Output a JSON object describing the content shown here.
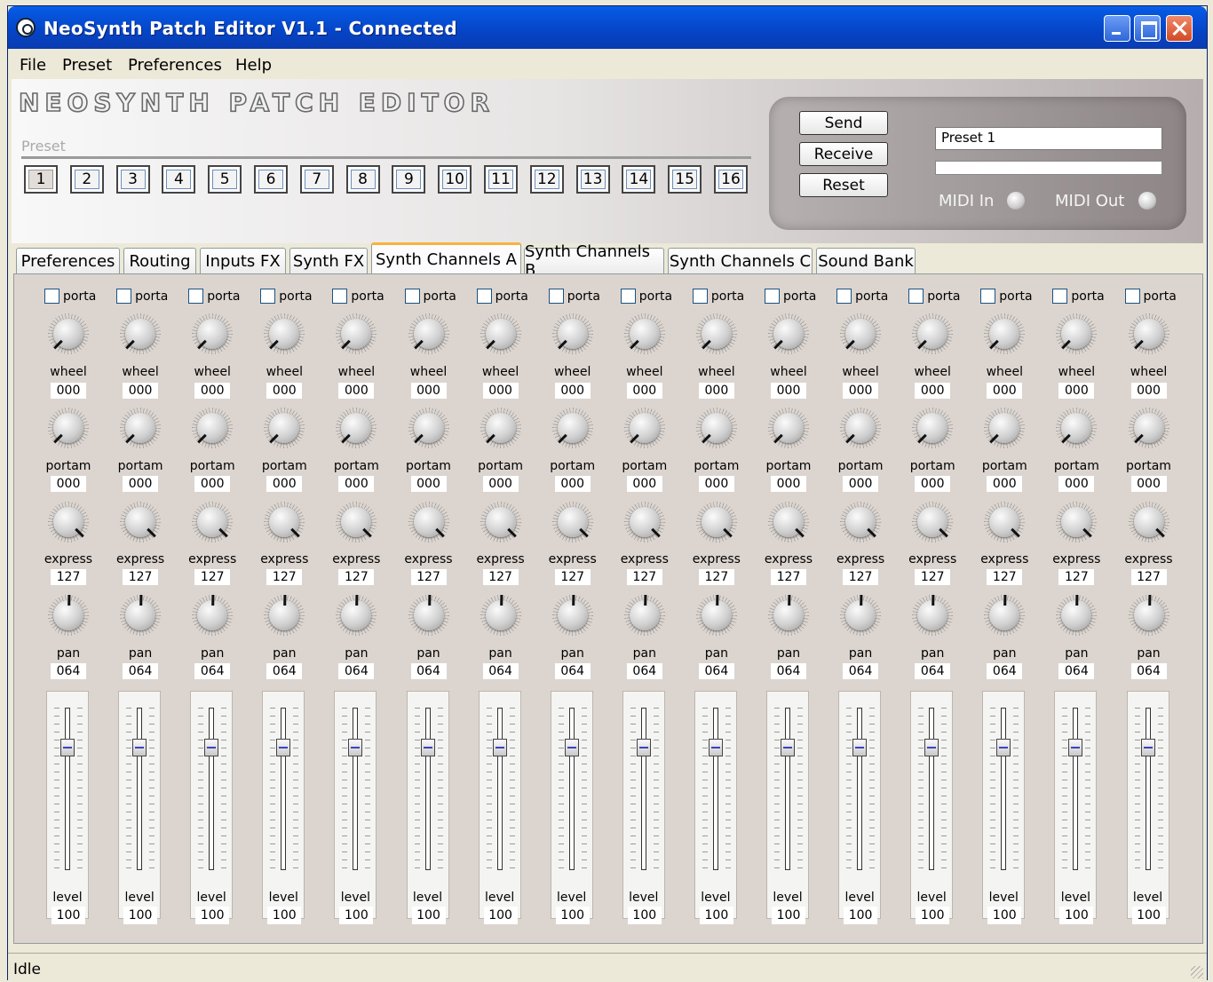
{
  "window": {
    "title": "NeoSynth Patch Editor V1.1 - Connected"
  },
  "menu": [
    "File",
    "Preset",
    "Preferences",
    "Help"
  ],
  "header": {
    "logo": "NEOSYNTH PATCH EDITOR",
    "preset_label": "Preset",
    "preset_buttons": [
      "1",
      "2",
      "3",
      "4",
      "5",
      "6",
      "7",
      "8",
      "9",
      "10",
      "11",
      "12",
      "13",
      "14",
      "15",
      "16"
    ],
    "selected_preset": "1"
  },
  "controls": {
    "send": "Send",
    "receive": "Receive",
    "reset": "Reset",
    "preset_name": "Preset 1",
    "progress": 0,
    "midi_in": "MIDI In",
    "midi_out": "MIDI Out"
  },
  "tabs": [
    "Preferences",
    "Routing",
    "Inputs FX",
    "Synth FX",
    "Synth Channels A",
    "Synth Channels B",
    "Synth Channels C",
    "Sound Bank"
  ],
  "active_tab": "Synth Channels A",
  "channel_labels": {
    "porta": "porta",
    "wheel": "wheel",
    "portam": "portam",
    "express": "express",
    "pan": "pan",
    "level": "level"
  },
  "channels": [
    {
      "porta": false,
      "wheel": "000",
      "portam": "000",
      "express": "127",
      "pan": "064",
      "level": "100"
    },
    {
      "porta": false,
      "wheel": "000",
      "portam": "000",
      "express": "127",
      "pan": "064",
      "level": "100"
    },
    {
      "porta": false,
      "wheel": "000",
      "portam": "000",
      "express": "127",
      "pan": "064",
      "level": "100"
    },
    {
      "porta": false,
      "wheel": "000",
      "portam": "000",
      "express": "127",
      "pan": "064",
      "level": "100"
    },
    {
      "porta": false,
      "wheel": "000",
      "portam": "000",
      "express": "127",
      "pan": "064",
      "level": "100"
    },
    {
      "porta": false,
      "wheel": "000",
      "portam": "000",
      "express": "127",
      "pan": "064",
      "level": "100"
    },
    {
      "porta": false,
      "wheel": "000",
      "portam": "000",
      "express": "127",
      "pan": "064",
      "level": "100"
    },
    {
      "porta": false,
      "wheel": "000",
      "portam": "000",
      "express": "127",
      "pan": "064",
      "level": "100"
    },
    {
      "porta": false,
      "wheel": "000",
      "portam": "000",
      "express": "127",
      "pan": "064",
      "level": "100"
    },
    {
      "porta": false,
      "wheel": "000",
      "portam": "000",
      "express": "127",
      "pan": "064",
      "level": "100"
    },
    {
      "porta": false,
      "wheel": "000",
      "portam": "000",
      "express": "127",
      "pan": "064",
      "level": "100"
    },
    {
      "porta": false,
      "wheel": "000",
      "portam": "000",
      "express": "127",
      "pan": "064",
      "level": "100"
    },
    {
      "porta": false,
      "wheel": "000",
      "portam": "000",
      "express": "127",
      "pan": "064",
      "level": "100"
    },
    {
      "porta": false,
      "wheel": "000",
      "portam": "000",
      "express": "127",
      "pan": "064",
      "level": "100"
    },
    {
      "porta": false,
      "wheel": "000",
      "portam": "000",
      "express": "127",
      "pan": "064",
      "level": "100"
    },
    {
      "porta": false,
      "wheel": "000",
      "portam": "000",
      "express": "127",
      "pan": "064",
      "level": "100"
    }
  ],
  "status": {
    "text": "Idle"
  }
}
